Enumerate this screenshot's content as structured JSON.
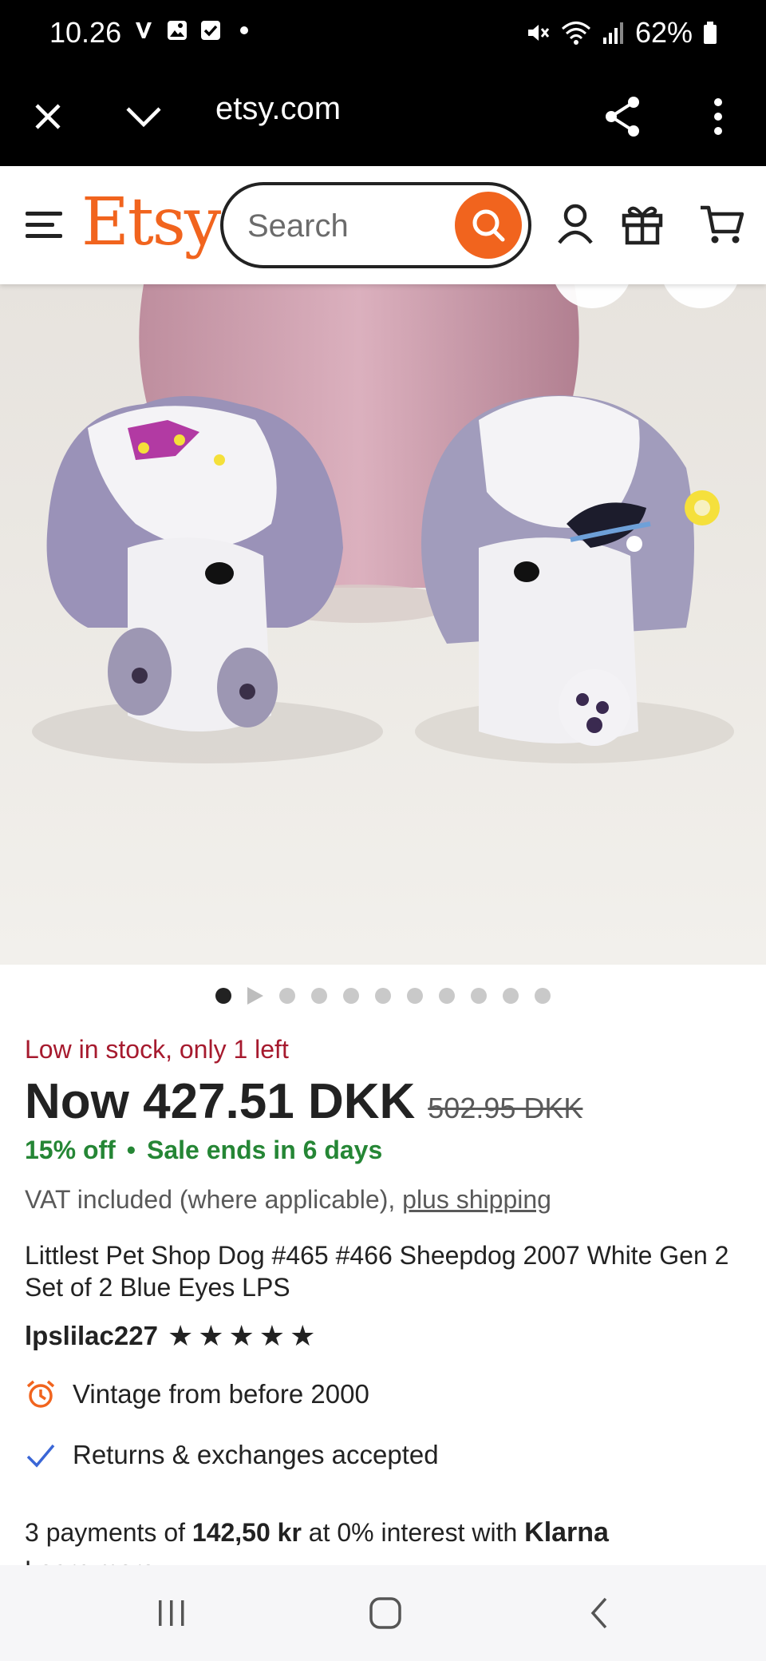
{
  "status_bar": {
    "time": "10.26",
    "battery": "62%"
  },
  "browser": {
    "url": "etsy.com",
    "close_icon": "close-icon",
    "menu_icon": "more-vert-icon"
  },
  "header": {
    "logo": "Etsy",
    "search_placeholder": "Search"
  },
  "gallery": {
    "dot_count": 11,
    "active_index": 0
  },
  "product": {
    "stock": "Low in stock, only 1 left",
    "price_now": "Now 427.51 DKK",
    "price_old": "502.95 DKK",
    "discount": "15% off",
    "separator": "•",
    "sale_ends": "Sale ends in 6 days",
    "vat_text": "VAT included (where applicable),",
    "vat_link": "plus shipping",
    "title": "Littlest Pet Shop Dog #465 #466 Sheepdog 2007 White Gen 2 Set of 2 Blue Eyes LPS",
    "shop_name": "lpslilac227",
    "rating": 5,
    "feature_vintage": "Vintage from before 2000",
    "feature_returns": "Returns & exchanges accepted"
  },
  "klarna": {
    "prefix": "3 payments of",
    "amount": "142,50 kr",
    "middle": "at 0% interest with",
    "brand": "Klarna",
    "learn_more": "Learn more"
  },
  "colors": {
    "brand": "#f1641e",
    "stock": "#a61a2e",
    "sale": "#258635"
  }
}
